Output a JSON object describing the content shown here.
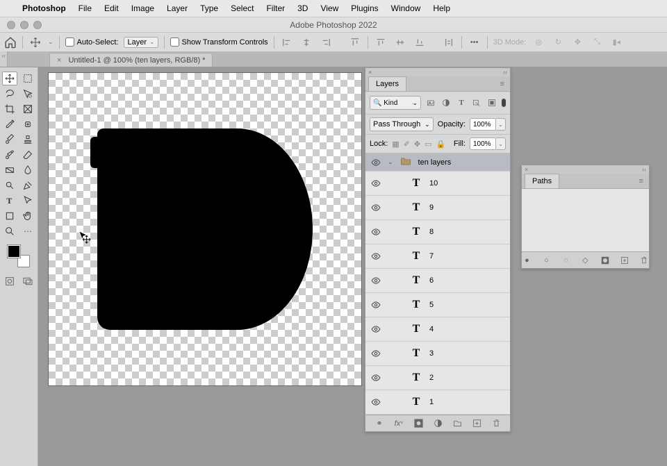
{
  "menubar": {
    "app": "Photoshop",
    "items": [
      "File",
      "Edit",
      "Image",
      "Layer",
      "Type",
      "Select",
      "Filter",
      "3D",
      "View",
      "Plugins",
      "Window",
      "Help"
    ]
  },
  "titlebar": {
    "title": "Adobe Photoshop 2022"
  },
  "options": {
    "auto_select_label": "Auto-Select:",
    "auto_select_target": "Layer",
    "show_transform_label": "Show Transform Controls",
    "mode3d_label": "3D Mode:"
  },
  "document_tab": {
    "title": "Untitled-1 @ 100% (ten layers, RGB/8) *"
  },
  "layers_panel": {
    "title": "Layers",
    "filter_label": "Kind",
    "blend_mode": "Pass Through",
    "opacity_label": "Opacity:",
    "opacity_value": "100%",
    "lock_label": "Lock:",
    "fill_label": "Fill:",
    "fill_value": "100%",
    "group_name": "ten layers",
    "items": [
      {
        "name": "10"
      },
      {
        "name": "9"
      },
      {
        "name": "8"
      },
      {
        "name": "7"
      },
      {
        "name": "6"
      },
      {
        "name": "5"
      },
      {
        "name": "4"
      },
      {
        "name": "3"
      },
      {
        "name": "2"
      },
      {
        "name": "1"
      }
    ]
  },
  "paths_panel": {
    "title": "Paths"
  }
}
